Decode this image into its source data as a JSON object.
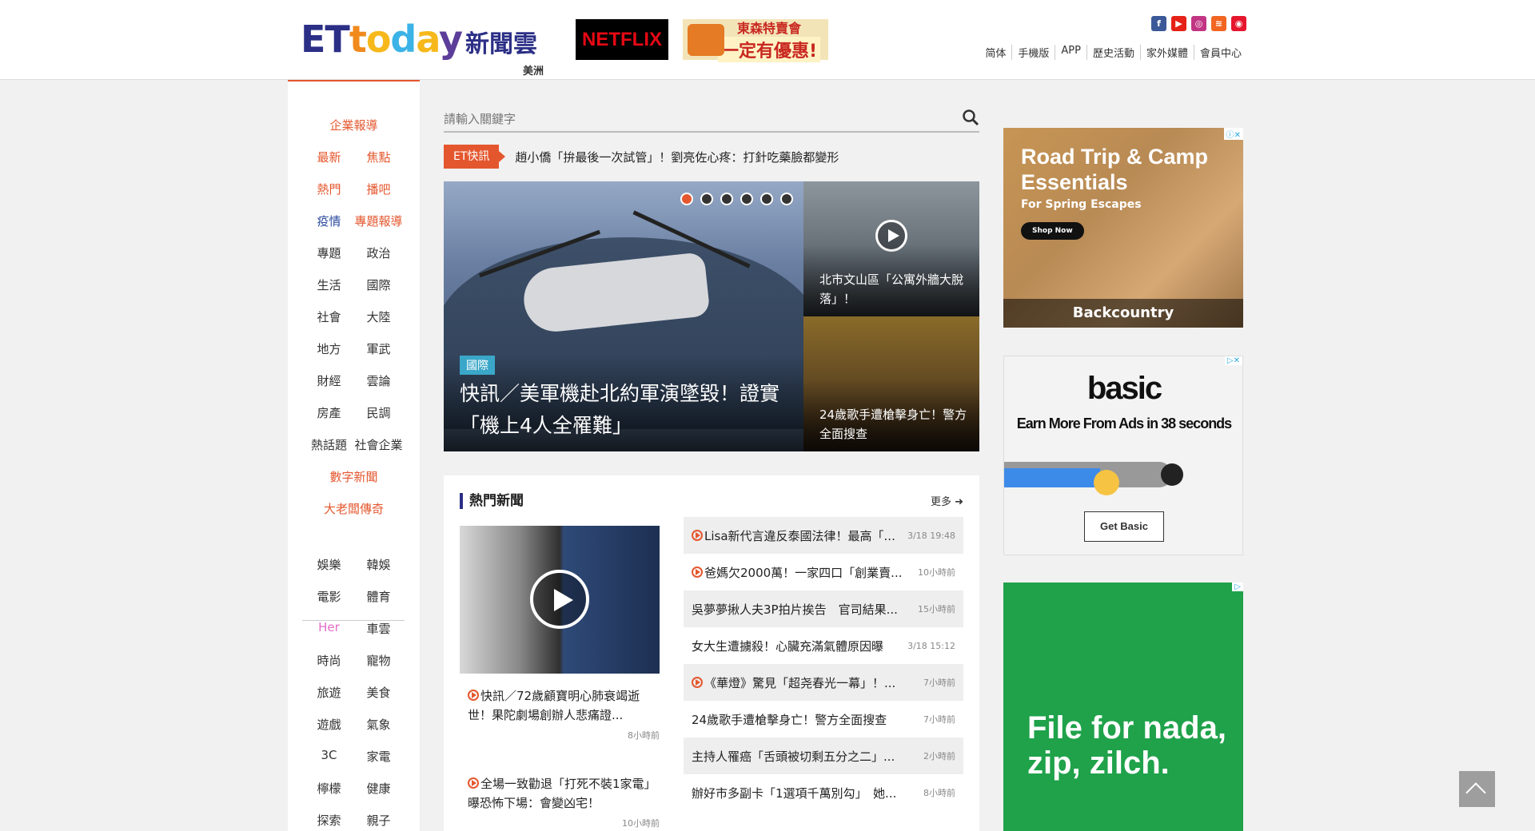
{
  "header": {
    "logo_et": "ET",
    "logo_today": [
      "t",
      "o",
      "d",
      "a",
      "y"
    ],
    "logo_cloud": "新聞雲",
    "region": "美洲",
    "netflix": "NETFLIX",
    "tosen_line1": "東森特賣會",
    "tosen_line2": "一定有優惠!",
    "social": [
      "f",
      "▶",
      "◎",
      "≋",
      "◉"
    ],
    "nav": [
      "简体",
      "手機版",
      "APP",
      "歷史活動",
      "家外媒體",
      "會員中心"
    ]
  },
  "sidebar": {
    "rows": [
      [
        "企業報導"
      ],
      [
        "最新",
        "焦點"
      ],
      [
        "熱門",
        "播吧"
      ],
      [
        "疫情",
        "專題報導"
      ],
      [
        "專題",
        "政治"
      ],
      [
        "生活",
        "國際"
      ],
      [
        "社會",
        "大陸"
      ],
      [
        "地方",
        "軍武"
      ],
      [
        "財經",
        "雲論"
      ],
      [
        "房產",
        "民調"
      ],
      [
        "熱話題",
        "社會企業"
      ],
      [
        "數字新聞"
      ],
      [
        "大老闆傳奇"
      ],
      [
        "娛樂",
        "韓娛"
      ],
      [
        "電影",
        "體育"
      ],
      [
        "Her",
        "車雲"
      ],
      [
        "時尚",
        "寵物"
      ],
      [
        "旅遊",
        "美食"
      ],
      [
        "遊戲",
        "氣象"
      ],
      [
        "3C",
        "家電"
      ],
      [
        "檸檬",
        "健康"
      ],
      [
        "探索",
        "親子"
      ]
    ]
  },
  "search": {
    "placeholder": "請輸入關鍵字"
  },
  "flash": {
    "tag": "ET快訊",
    "text": "趙小僑「拚最後一次試管」！劉亮佐心疼：打針吃藥臉都變形"
  },
  "hero": {
    "category": "國際",
    "title": "快訊／美軍機赴北約軍演墜毀！證實「機上4人全罹難」",
    "slides": 6,
    "active_slide": 0
  },
  "side_cards": [
    {
      "text": "北市文山區「公寓外牆大脫落」！"
    },
    {
      "text": "24歲歌手遭槍擊身亡！警方全面搜查"
    }
  ],
  "hot": {
    "heading": "熱門新聞",
    "more": "更多",
    "lead": [
      {
        "title": "快訊／72歲顧寶明心肺衰竭逝世！果陀劇場創辦人悲痛證...",
        "time": "8小時前"
      },
      {
        "title": "全場一致勸退「打死不裝1家電」　曝恐怖下場：會變凶宅！",
        "time": "10小時前"
      }
    ],
    "list": [
      {
        "title": "Lisa新代言違反泰國法律！最高「...",
        "time": "3/18 19:48",
        "video": true
      },
      {
        "title": "爸媽欠2000萬！一家四口「創業賣...",
        "time": "10小時前",
        "video": true
      },
      {
        "title": "吳夢夢揪人夫3P拍片挨告　官司結果...",
        "time": "15小時前",
        "video": false
      },
      {
        "title": "女大生遭擄殺！心臟充滿氣體原因曝",
        "time": "3/18 15:12",
        "video": false
      },
      {
        "title": "《華燈》驚見「超尧春光一幕」！...",
        "time": "7小時前",
        "video": true
      },
      {
        "title": "24歲歌手遭槍擊身亡！警方全面搜查",
        "time": "7小時前",
        "video": false
      },
      {
        "title": "主持人罹癌「舌頭被切剩五分之二」...",
        "time": "2小時前",
        "video": false
      },
      {
        "title": "辦好市多副卡「1選項千萬別勾」　她...",
        "time": "8小時前",
        "video": false
      }
    ]
  },
  "ads": {
    "ad1": {
      "headline": "Road Trip & Camp Essentials",
      "sub": "For Spring Escapes",
      "button": "Shop Now",
      "brand": "Backcountry"
    },
    "ad2": {
      "logo": "basic",
      "text": "Earn More From Ads in 38 seconds",
      "button": "Get Basic"
    },
    "ad3": {
      "headline": "File for nada, zip, zilch."
    }
  },
  "colors": {
    "accent": "#e4572e",
    "brand": "#2b2f86"
  }
}
